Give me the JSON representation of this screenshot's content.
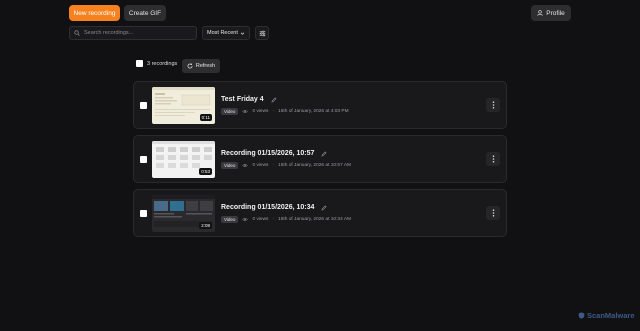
{
  "header": {
    "new_recording_label": "New recording",
    "create_gif_label": "Create GIF",
    "profile_label": "Profile"
  },
  "toolbar": {
    "search_placeholder": "Search recordings...",
    "sort_value": "Most Recent"
  },
  "selection": {
    "count_label": "3 recordings",
    "refresh_label": "Refresh"
  },
  "recordings": [
    {
      "title": "Test Friday 4",
      "type": "Video",
      "views": "0 views",
      "date": "16th of January, 2026 at 4:03 PM",
      "duration": "0:11"
    },
    {
      "title": "Recording 01/15/2026, 10:57",
      "type": "Video",
      "views": "0 views",
      "date": "15th of January, 2026 at 10:57 AM",
      "duration": "0:53"
    },
    {
      "title": "Recording 01/15/2026, 10:34",
      "type": "Video",
      "views": "0 views",
      "date": "15th of January, 2026 at 10:34 AM",
      "duration": "2:08"
    }
  ],
  "watermark": "ScanMalware",
  "colors": {
    "accent": "#f5821f",
    "background": "#111113",
    "card": "#19191b"
  }
}
